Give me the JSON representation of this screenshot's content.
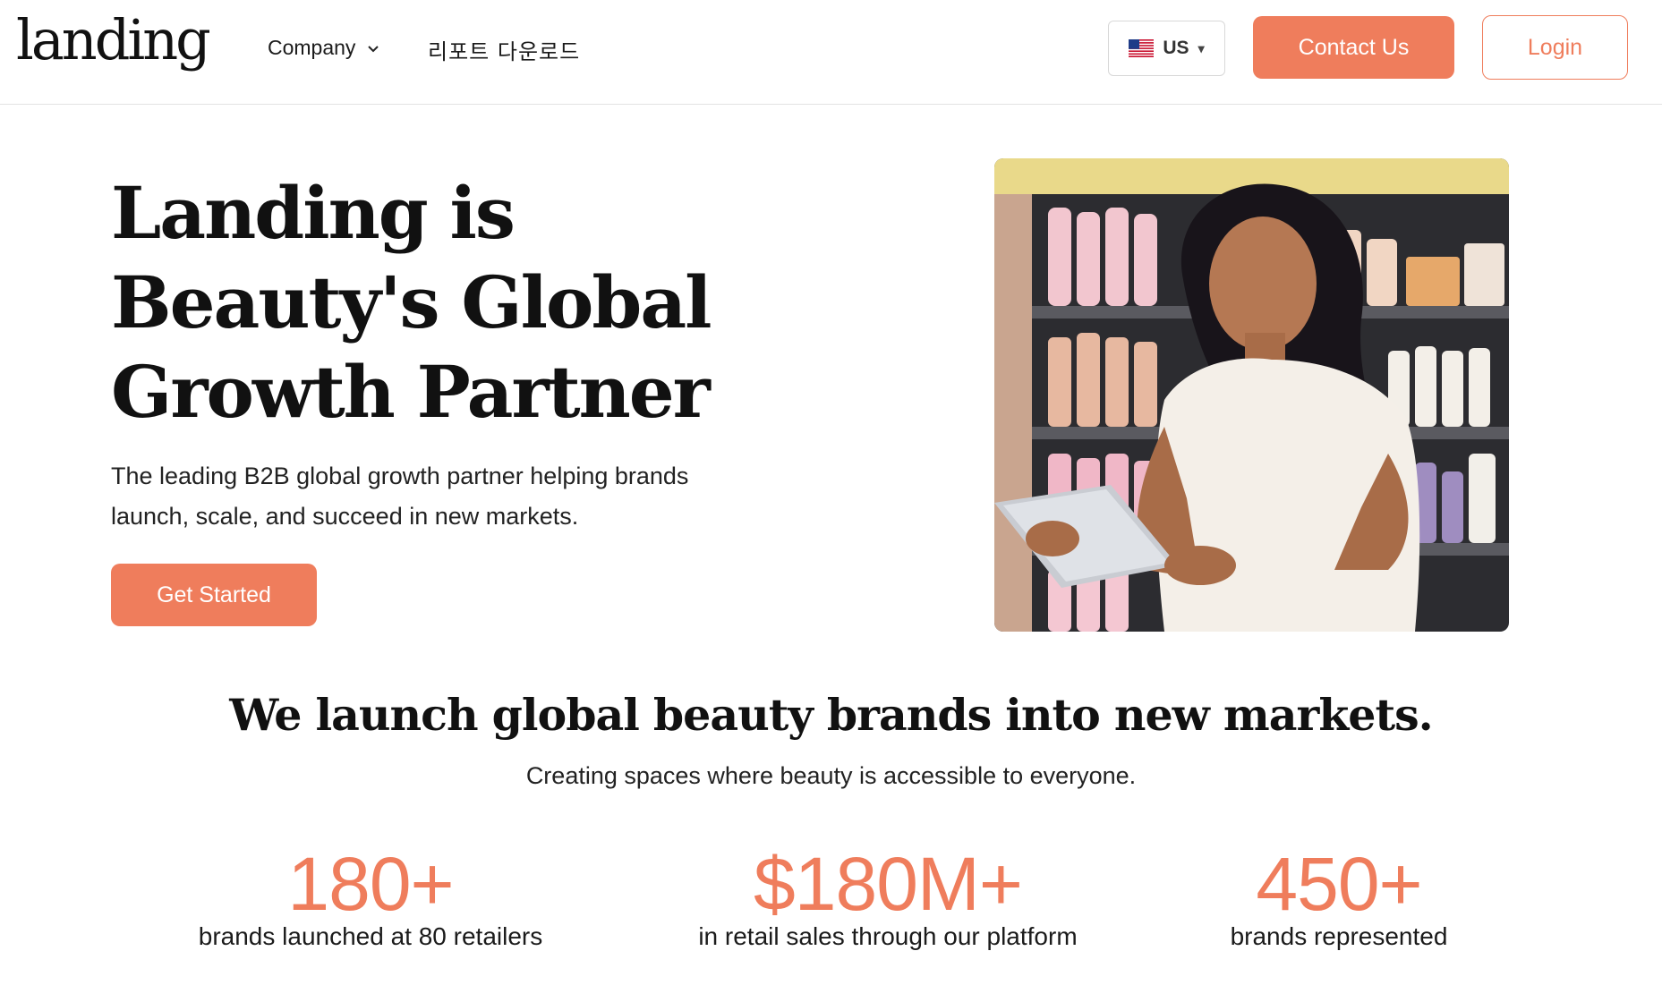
{
  "header": {
    "logo": "landing",
    "nav": {
      "company_label": "Company",
      "report_label": "리포트 다운로드"
    },
    "locale": {
      "label": "US",
      "flag_icon": "us-flag-icon"
    },
    "contact_label": "Contact Us",
    "login_label": "Login"
  },
  "hero": {
    "title": "Landing is Beauty's Global Growth Partner",
    "subtitle": "The leading B2B global growth partner helping brands launch, scale, and succeed in new markets.",
    "cta_label": "Get Started"
  },
  "mission": {
    "title": "We launch global beauty brands into new markets.",
    "subtitle": "Creating spaces where beauty is accessible to everyone."
  },
  "stats": [
    {
      "value": "180+",
      "label": "brands launched at 80 retailers"
    },
    {
      "value": "$180M+",
      "label": "in retail sales through our platform"
    },
    {
      "value": "450+",
      "label": "brands represented"
    }
  ],
  "colors": {
    "accent": "#ef7d5c",
    "text": "#111111",
    "border": "#e2e2e2"
  }
}
